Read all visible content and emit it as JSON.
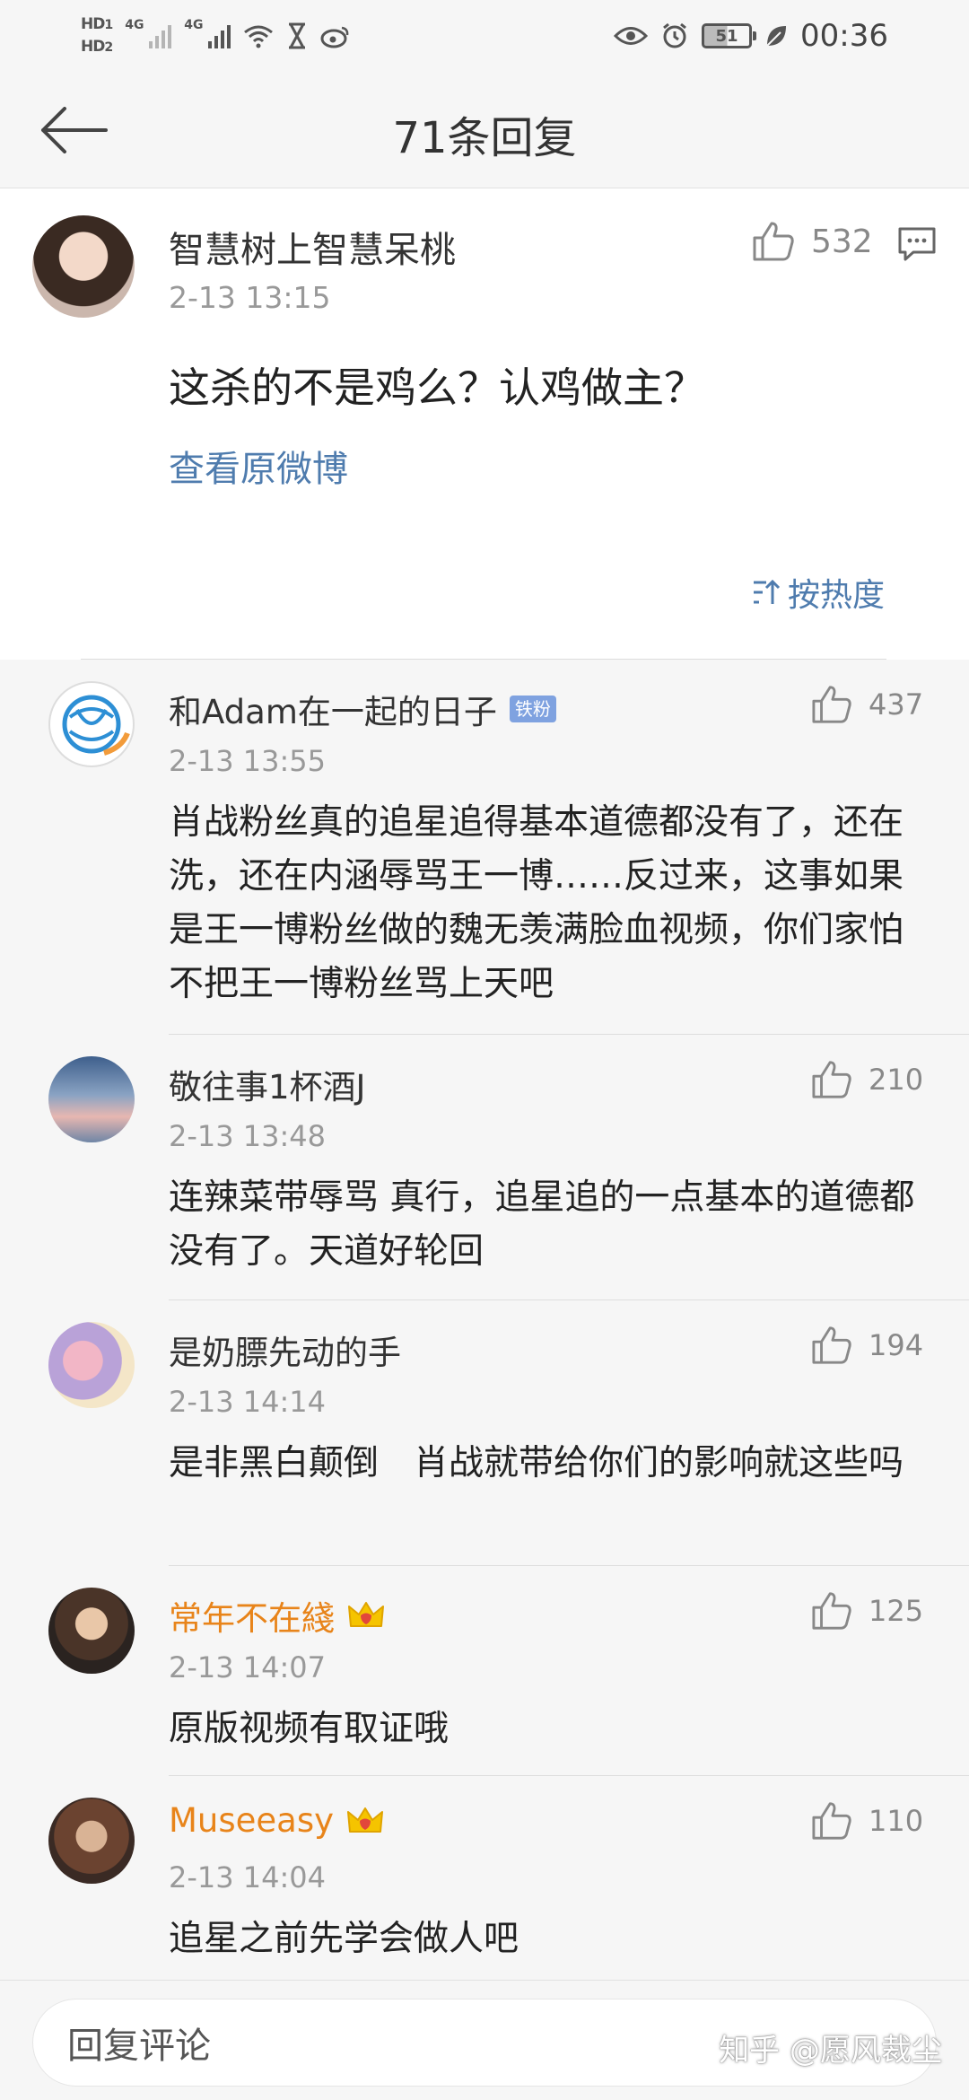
{
  "status_bar": {
    "hd1": "HD",
    "hd1_sub": "1",
    "hd2": "HD",
    "hd2_sub": "2",
    "net1": "4G",
    "net2": "4G",
    "battery": "51",
    "time": "00:36"
  },
  "header": {
    "title": "71条回复"
  },
  "main_comment": {
    "author": "智慧树上智慧呆桃",
    "time": "2-13 13:15",
    "likes": "532",
    "text": "这杀的不是鸡么？认鸡做主？",
    "view_original": "查看原微博",
    "sort_label": "按热度"
  },
  "replies": [
    {
      "author": "和Adam在一起的日子",
      "badge": "铁粉",
      "vip": false,
      "time": "2-13 13:55",
      "likes": "437",
      "text": "肖战粉丝真的追星追得基本道德都没有了，还在洗，还在内涵辱骂王一博……反过来，这事如果是王一博粉丝做的魏无羡满脸血视频，你们家怕不把王一博粉丝骂上天吧"
    },
    {
      "author": "敬往事1杯酒J",
      "badge": "",
      "vip": false,
      "time": "2-13 13:48",
      "likes": "210",
      "text": "连辣菜带辱骂 真行，追星追的一点基本的道德都没有了。天道好轮回"
    },
    {
      "author": "是奶膘先动的手",
      "badge": "",
      "vip": false,
      "time": "2-13 14:14",
      "likes": "194",
      "text": "是非黑白颠倒　肖战就带给你们的影响就这些吗"
    },
    {
      "author": "常年不在綫",
      "badge": "",
      "vip": true,
      "time": "2-13 14:07",
      "likes": "125",
      "text": "原版视频有取证哦"
    },
    {
      "author": "Museeasy",
      "badge": "",
      "vip": true,
      "time": "2-13 14:04",
      "likes": "110",
      "text": "追星之前先学会做人吧"
    }
  ],
  "bottom": {
    "input_placeholder": "回复评论",
    "watermark": "知乎 @愿风裁尘"
  },
  "colors": {
    "link_blue": "#4f7cae",
    "vip_orange": "#e8841a",
    "badge_blue": "#7fa2e0",
    "crown_yellow": "#f5c400",
    "crown_red": "#e2473b"
  },
  "icons": {
    "back": "arrow-left-icon",
    "like": "thumbs-up-icon",
    "reply": "comment-icon",
    "sort": "sort-icon",
    "vip": "crown-icon",
    "eye": "eye-icon",
    "alarm": "alarm-icon",
    "wifi": "wifi-icon",
    "weibo": "weibo-icon",
    "hourglass": "hourglass-icon",
    "leaf": "leaf-icon"
  }
}
